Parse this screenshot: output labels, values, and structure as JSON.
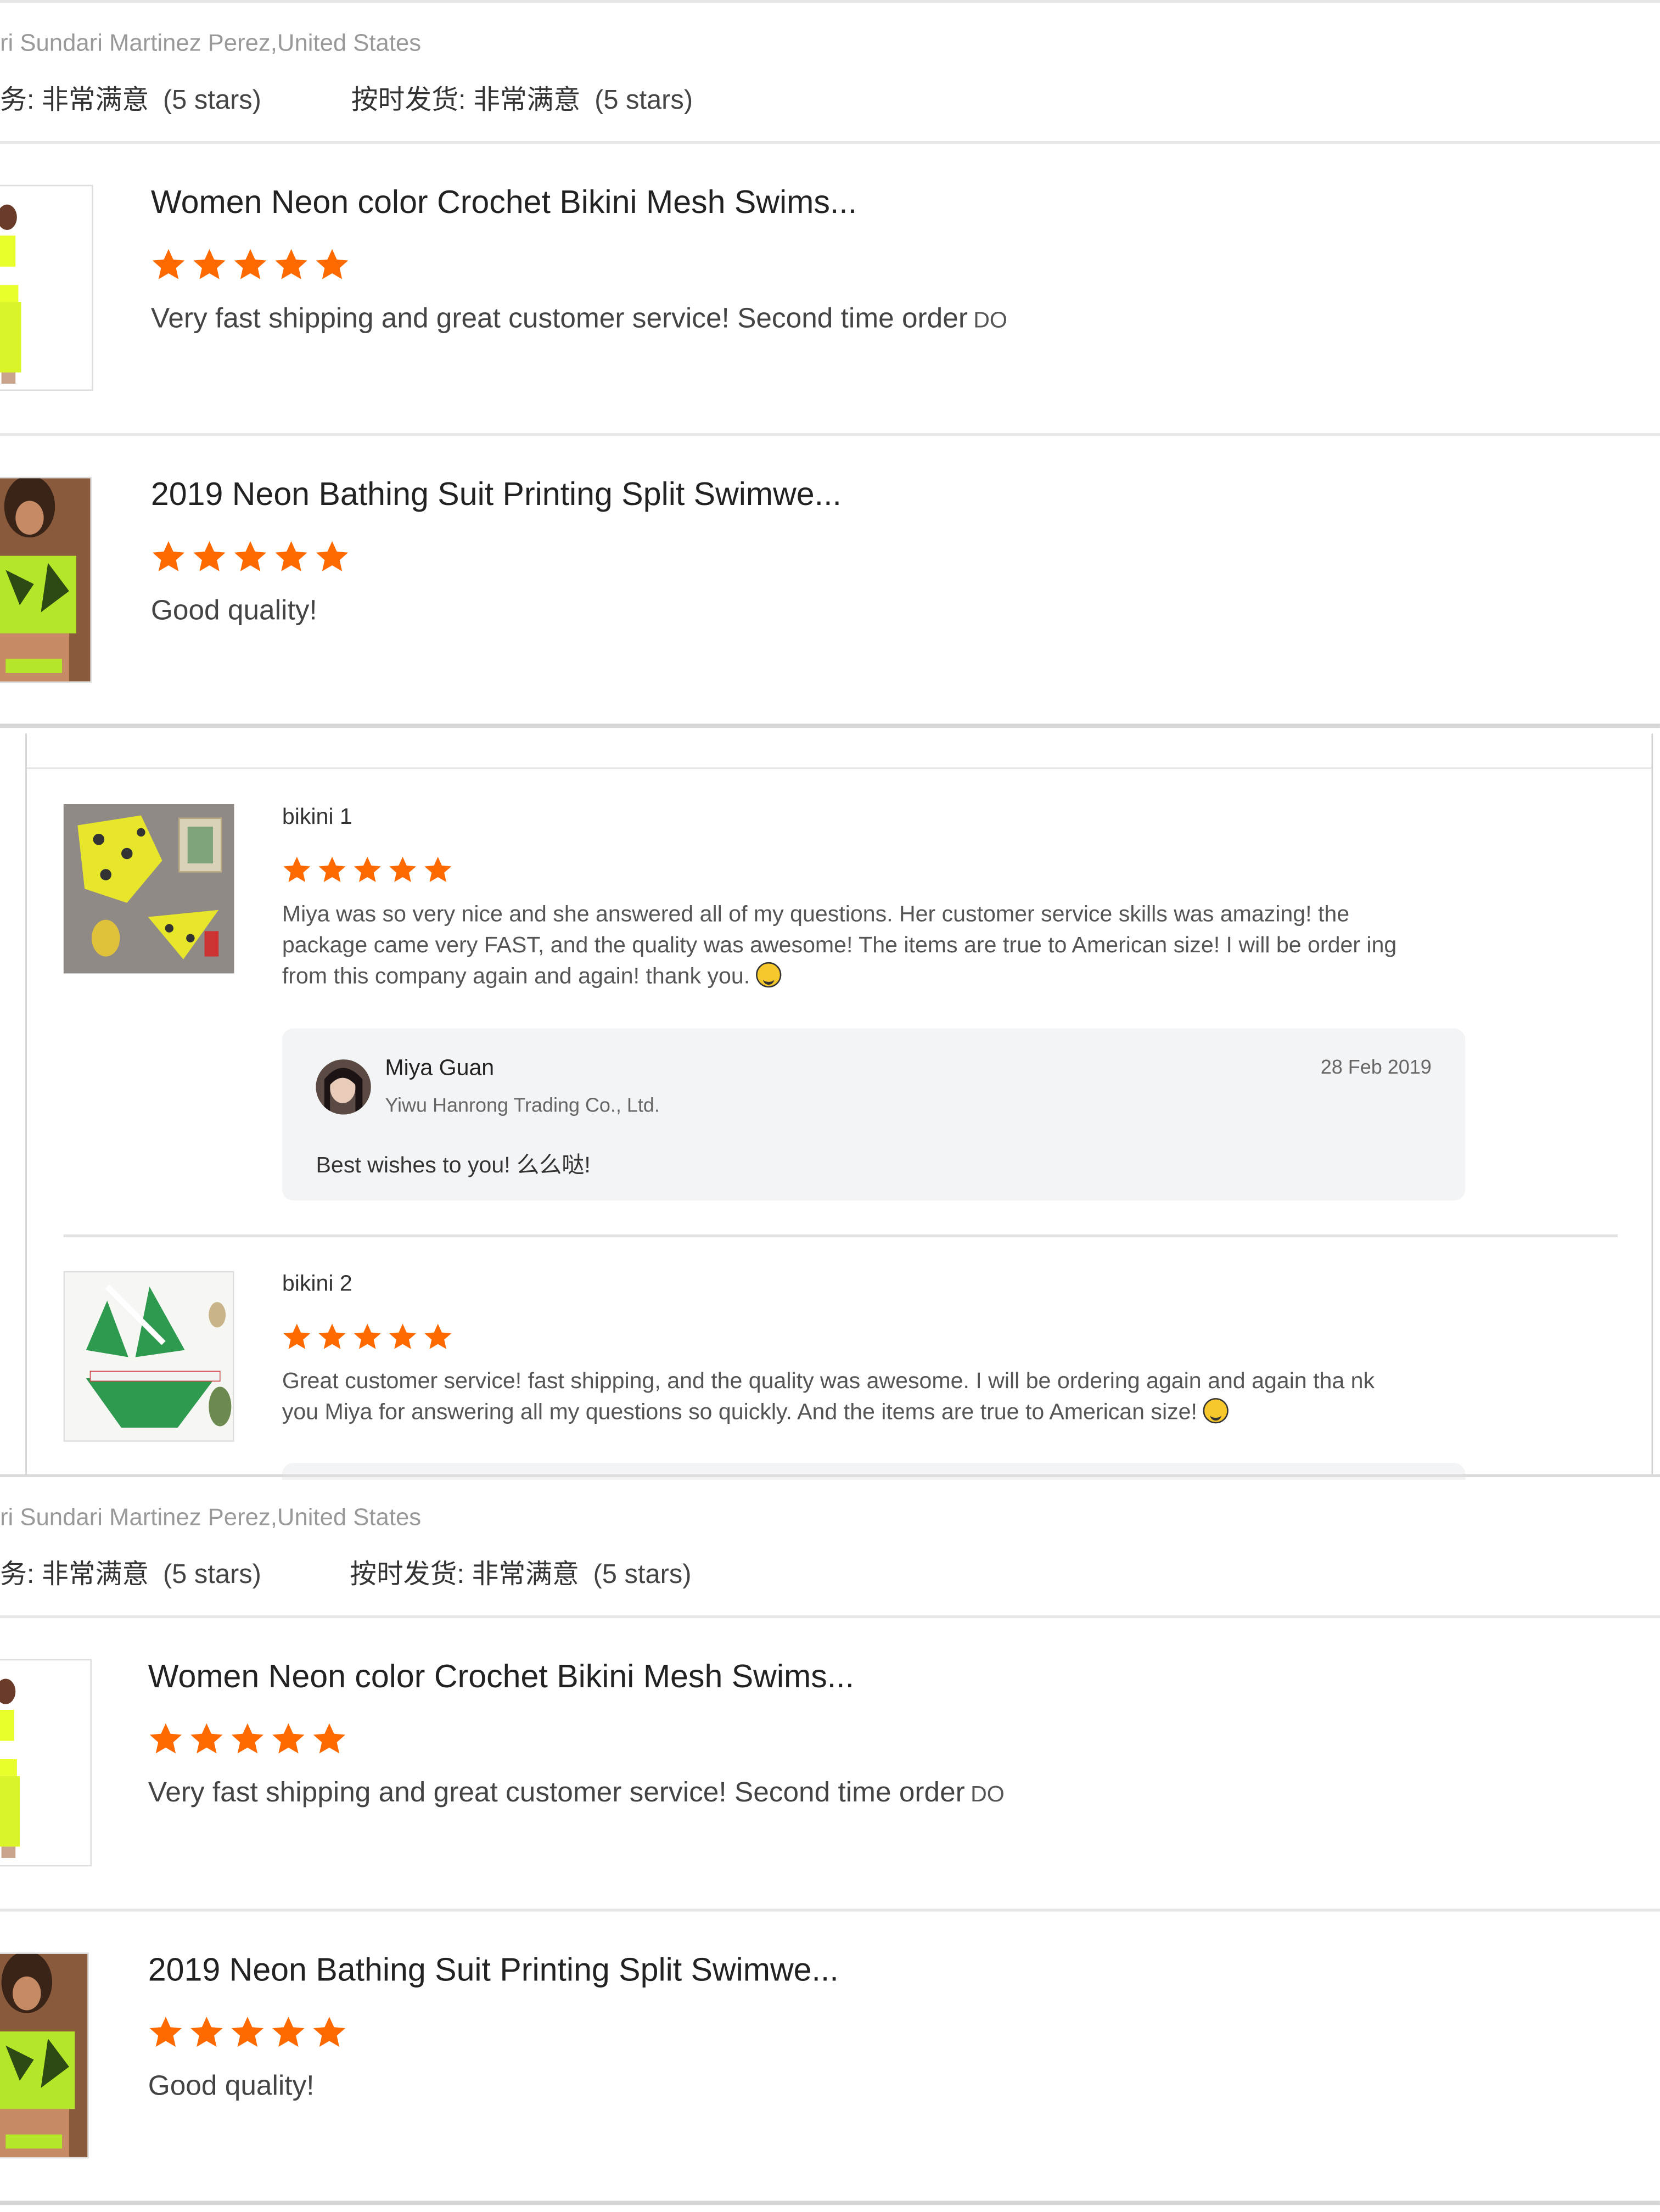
{
  "colors": {
    "star": "#ff6a00",
    "divider": "#e6e6e6",
    "reply_bg": "#f3f4f6"
  },
  "top": {
    "buyer": "ri Sundari Martinez Perez,United States",
    "service_label": "务: 非常满意",
    "service_stars": "(5 stars)",
    "shipping_label": "按时发货: 非常满意",
    "shipping_stars": "(5 stars)",
    "items": [
      {
        "title": "Women Neon color Crochet Bikini Mesh Swims...",
        "rating": 5,
        "comment": "Very fast shipping and great customer service! Second time order",
        "tag": "DO"
      },
      {
        "title": "2019 Neon Bathing Suit Printing Split Swimwe...",
        "rating": 5,
        "comment": "Good quality!"
      }
    ]
  },
  "middle": {
    "items": [
      {
        "title": "bikini 1",
        "rating": 5,
        "comment": "Miya was so very nice and she answered all of my questions. Her customer service skills was amazing! the package came very FAST, and the quality was awesome! The items are true to American size! I will be order ing from this company again and again! thank you.",
        "reply": {
          "name": "Miya Guan",
          "company": "Yiwu Hanrong Trading Co., Ltd.",
          "date": "28 Feb 2019",
          "text": "Best wishes to you! 么么哒!"
        }
      },
      {
        "title": "bikini 2",
        "rating": 5,
        "comment": "Great customer service! fast shipping, and the quality was awesome. I will be ordering again and again tha nk you Miya for answering all my questions so quickly. And the items are true to American size!"
      }
    ]
  },
  "bottom": {
    "buyer": "ri Sundari Martinez Perez,United States",
    "service_label": "务: 非常满意",
    "service_stars": "(5 stars)",
    "shipping_label": "按时发货: 非常满意",
    "shipping_stars": "(5 stars)",
    "items": [
      {
        "title": "Women Neon color Crochet Bikini Mesh Swims...",
        "rating": 5,
        "comment": "Very fast shipping and great customer service! Second time order",
        "tag": "DO"
      },
      {
        "title": "2019 Neon Bathing Suit Printing Split Swimwe...",
        "rating": 5,
        "comment": "Good quality!"
      }
    ]
  }
}
